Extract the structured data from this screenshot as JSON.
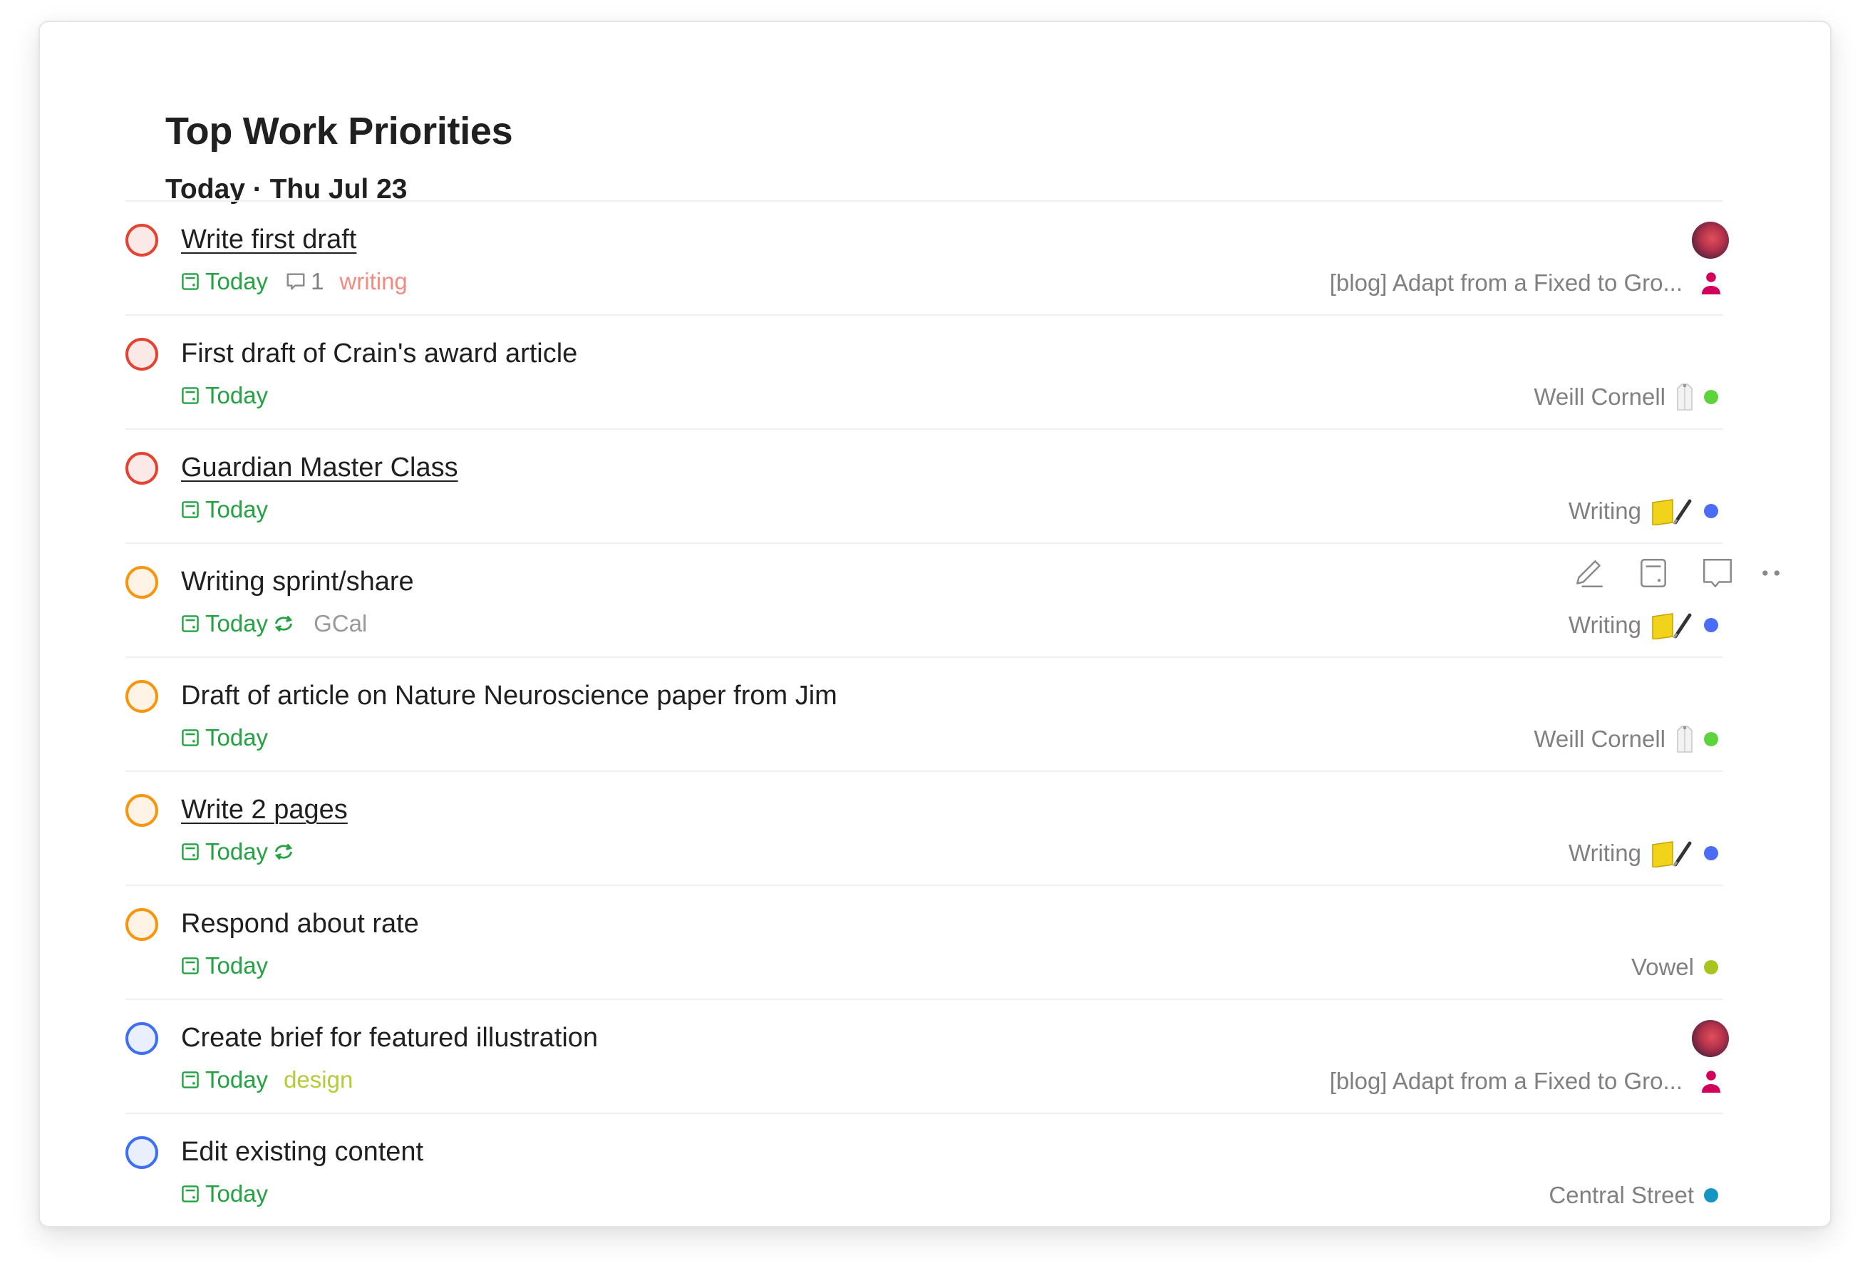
{
  "header": {
    "title": "Top Work Priorities",
    "section": "Today · Thu Jul 23"
  },
  "colors": {
    "p1": "#e44332",
    "p2": "#f6960f",
    "p3": "#3d6ff2",
    "due_today": "#25a244"
  },
  "hover_actions": {
    "edit": "edit-icon",
    "schedule": "calendar-icon",
    "comment": "comment-icon",
    "more": "more-icon"
  },
  "tasks": [
    {
      "title": "Write first draft",
      "priority": "p1",
      "due": "Today",
      "comments": "1",
      "label": "writing",
      "label_color": "#f28b82",
      "project": "[blog] Adapt from a Fixed to Gro...",
      "assignee_icon": "person-icon",
      "has_avatar": true
    },
    {
      "title": "First draft of Crain's award article",
      "priority": "p1",
      "due": "Today",
      "project": "Weill Cornell",
      "project_icon": "lab-coat-icon",
      "project_color": "#5fd33e"
    },
    {
      "title": "Guardian Master Class",
      "priority": "p1",
      "due": "Today",
      "project": "Writing",
      "project_icon": "book-pen-icon",
      "project_color": "#4a6cf7"
    },
    {
      "title": "Writing sprint/share",
      "priority": "p2",
      "due": "Today",
      "recurring": true,
      "source": "GCal",
      "project": "Writing",
      "project_icon": "book-pen-icon",
      "project_color": "#4a6cf7"
    },
    {
      "title": "Draft of article on Nature Neuroscience paper from Jim",
      "priority": "p2",
      "due": "Today",
      "project": "Weill Cornell",
      "project_icon": "lab-coat-icon",
      "project_color": "#5fd33e"
    },
    {
      "title": "Write 2 pages",
      "priority": "p2",
      "due": "Today",
      "recurring": true,
      "project": "Writing",
      "project_icon": "book-pen-icon",
      "project_color": "#4a6cf7"
    },
    {
      "title": "Respond about rate",
      "priority": "p2",
      "due": "Today",
      "project": "Vowel",
      "project_color": "#a8c41f"
    },
    {
      "title": "Create brief for featured illustration",
      "priority": "p3",
      "due": "Today",
      "label": "design",
      "label_color": "#b5cc3a",
      "project": "[blog] Adapt from a Fixed to Gro...",
      "assignee_icon": "person-icon",
      "has_avatar": true
    },
    {
      "title": "Edit existing content",
      "priority": "p3",
      "due": "Today",
      "project": "Central Street",
      "project_color": "#1496c4"
    }
  ]
}
